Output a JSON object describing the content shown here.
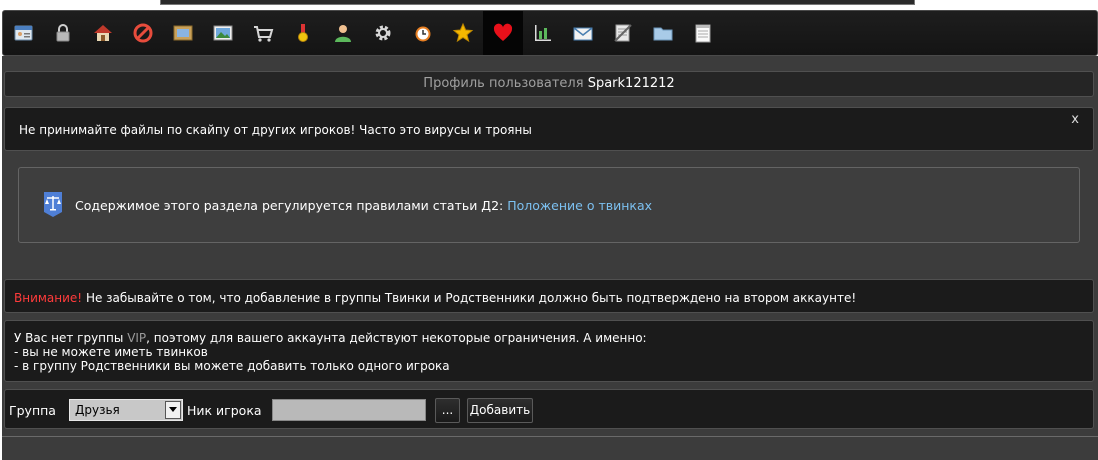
{
  "toolbar": {
    "items": [
      {
        "icon": "contact-card-icon"
      },
      {
        "icon": "lock-icon"
      },
      {
        "icon": "home-icon"
      },
      {
        "icon": "block-icon"
      },
      {
        "icon": "picture-frame-icon"
      },
      {
        "icon": "landscape-image-icon"
      },
      {
        "icon": "cart-icon"
      },
      {
        "icon": "medal-icon"
      },
      {
        "icon": "user-icon"
      },
      {
        "icon": "gear-icon"
      },
      {
        "icon": "alarm-clock-icon"
      },
      {
        "icon": "star-icon"
      },
      {
        "icon": "heart-icon",
        "active": true
      },
      {
        "icon": "bar-chart-icon"
      },
      {
        "icon": "mail-icon"
      },
      {
        "icon": "notes-icon"
      },
      {
        "icon": "folder-icon"
      },
      {
        "icon": "notepad-icon"
      }
    ]
  },
  "profile": {
    "title_prefix": "Профиль пользователя",
    "username": "Spark121212"
  },
  "notice": {
    "text": "Не принимайте файлы по скайпу от других игроков! Часто это вирусы и трояны",
    "close": "x"
  },
  "rules": {
    "text": "Содержимое этого раздела регулируется правилами статьи Д2:",
    "link": "Положение о твинках"
  },
  "warning": {
    "label": "Внимание!",
    "text": "Не забывайте о том, что добавление в группы Твинки и Родственники должно быть подтверждено на втором аккаунте!"
  },
  "vip_notice": {
    "line1_before": "У Вас нет группы",
    "vip": "VIP",
    "line1_after": ", поэтому для вашего аккаунта действуют некоторые ограничения. А именно:",
    "line2": "- вы не можете иметь твинков",
    "line3": "- в группу Родственники вы можете добавить только одного игрока"
  },
  "form": {
    "group_label": "Группа",
    "group_value": "Друзья",
    "nick_label": "Ник игрока",
    "nick_value": "",
    "browse_label": "...",
    "add_label": "Добавить"
  },
  "colors": {
    "warning_red": "#ff3b3b",
    "link_blue": "#7cc0f0"
  }
}
